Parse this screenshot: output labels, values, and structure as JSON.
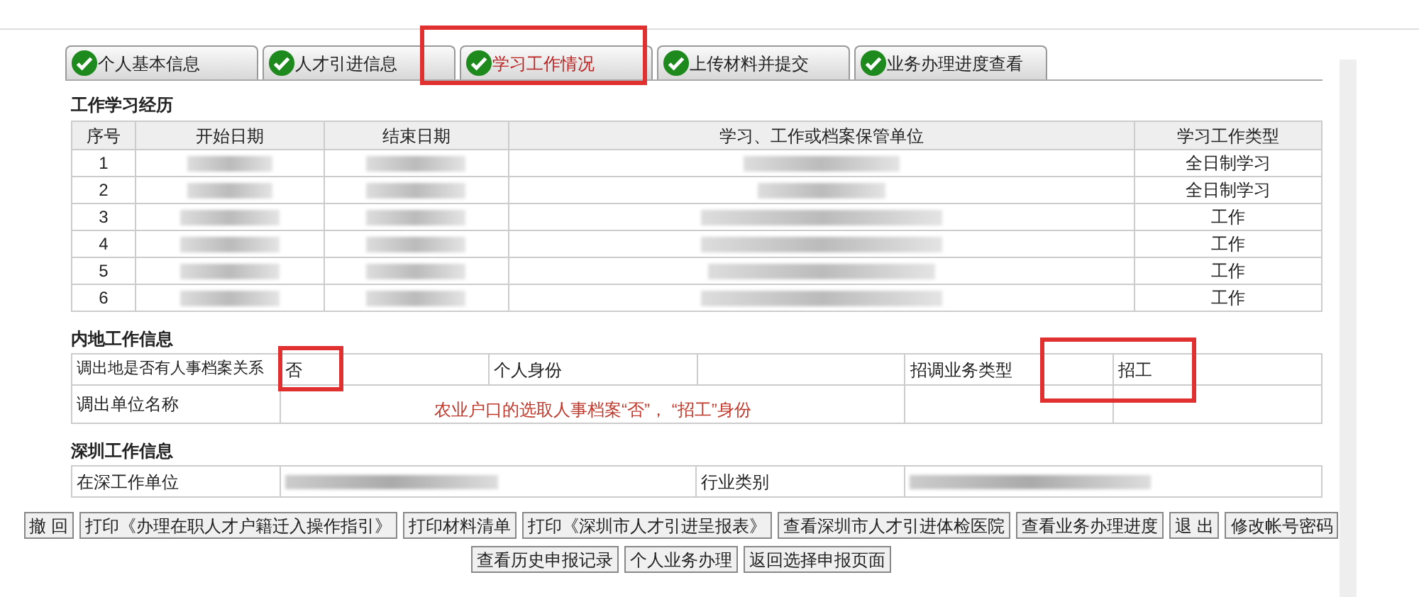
{
  "tabs": [
    {
      "label": "个人基本信息",
      "done": true,
      "selected": false,
      "highlighted": false
    },
    {
      "label": "人才引进信息",
      "done": true,
      "selected": false,
      "highlighted": false
    },
    {
      "label": "学习工作情况",
      "done": true,
      "selected": true,
      "highlighted": true
    },
    {
      "label": "上传材料并提交",
      "done": true,
      "selected": false,
      "highlighted": false
    },
    {
      "label": "业务办理进度查看",
      "done": true,
      "selected": false,
      "highlighted": false
    }
  ],
  "history": {
    "title": "工作学习经历",
    "columns": [
      "序号",
      "开始日期",
      "结束日期",
      "学习、工作或档案保管单位",
      "学习工作类型"
    ],
    "rows": [
      {
        "no": "1",
        "type": "全日制学习"
      },
      {
        "no": "2",
        "type": "全日制学习"
      },
      {
        "no": "3",
        "type": "工作"
      },
      {
        "no": "4",
        "type": "工作"
      },
      {
        "no": "5",
        "type": "工作"
      },
      {
        "no": "6",
        "type": "工作"
      }
    ]
  },
  "inland": {
    "title": "内地工作信息",
    "has_archive_label": "调出地是否有人事档案关系",
    "has_archive_value": "否",
    "has_archive_highlighted": true,
    "identity_label": "个人身份",
    "biz_type_label": "招调业务类型",
    "biz_type_value": "招工",
    "biz_type_highlighted": true,
    "unit_label": "调出单位名称",
    "note": "农业户口的选取人事档案“否”， “招工”身份"
  },
  "shenzhen": {
    "title": "深圳工作信息",
    "unit_label": "在深工作单位",
    "industry_label": "行业类别"
  },
  "buttons": [
    [
      "撤 回",
      "打印《办理在职人才户籍迁入操作指引》",
      "打印材料清单",
      "打印《深圳市人才引进呈报表》",
      "查看深圳市人才引进体检医院",
      "查看业务办理进度",
      "退 出",
      "修改帐号密码"
    ],
    [
      "查看历史申报记录",
      "个人业务办理",
      "返回选择申报页面"
    ]
  ]
}
